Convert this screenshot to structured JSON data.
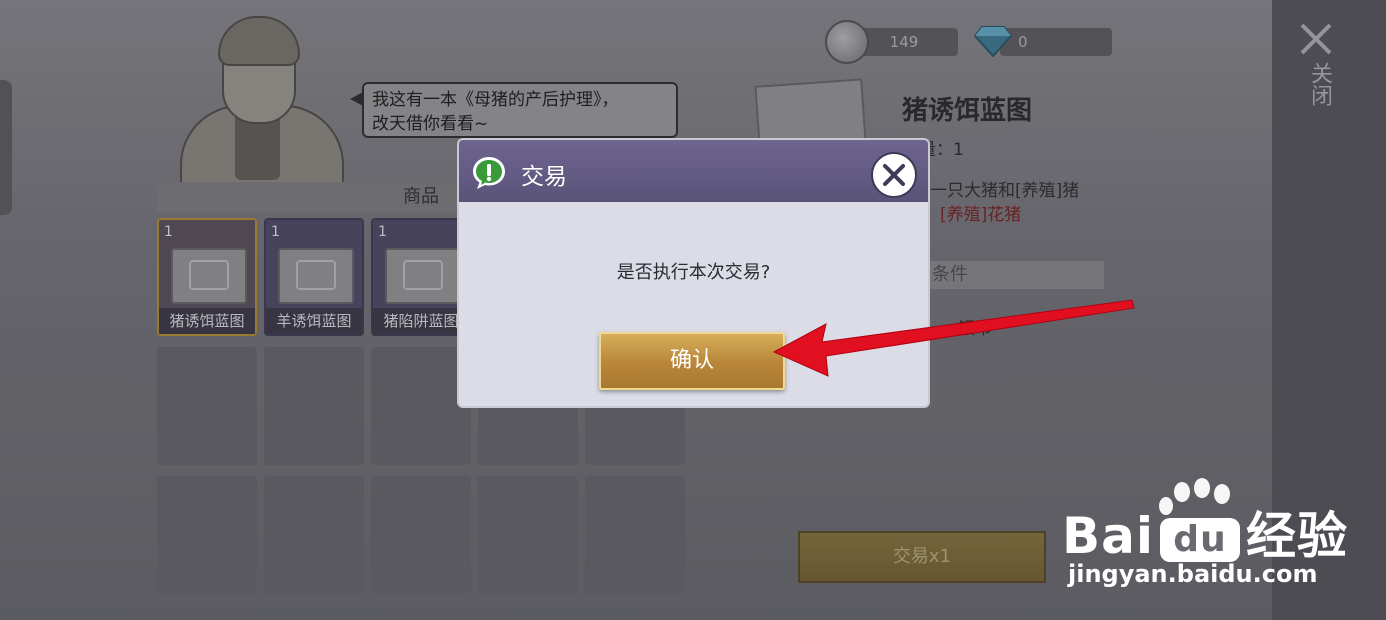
{
  "npc": {
    "speech_line1": "我这有一本《母猪的产后护理》，",
    "speech_line2": "改天借你看看~"
  },
  "shop": {
    "header": "商品",
    "items": [
      {
        "qty": "1",
        "name": "猪诱饵蓝图",
        "selected": true
      },
      {
        "qty": "1",
        "name": "羊诱饵蓝图",
        "selected": false
      },
      {
        "qty": "1",
        "name": "猪陷阱蓝图",
        "selected": false
      }
    ]
  },
  "currency": {
    "silver": "149",
    "diamond": "0"
  },
  "detail": {
    "title": "猪诱饵蓝图",
    "quantity": "数量：1",
    "desc_line1": "一只大猪和[养殖]猪",
    "desc_line2": "[养殖]花猪",
    "conditions_header": "交易条件",
    "condition_text": "银币",
    "trade_button": "交易x1"
  },
  "side": {
    "close_label": "关闭"
  },
  "dialog": {
    "title": "交易",
    "message": "是否执行本次交易?",
    "confirm": "确认"
  },
  "watermark": {
    "brand": "Bai",
    "brand_suffix": "经验",
    "url": "jingyan.baidu.com"
  },
  "colors": {
    "dialog_header": "#5f5880",
    "confirm_gold": "#c69a48",
    "arrow_red": "#e01020",
    "red_text": "#6e2323"
  }
}
